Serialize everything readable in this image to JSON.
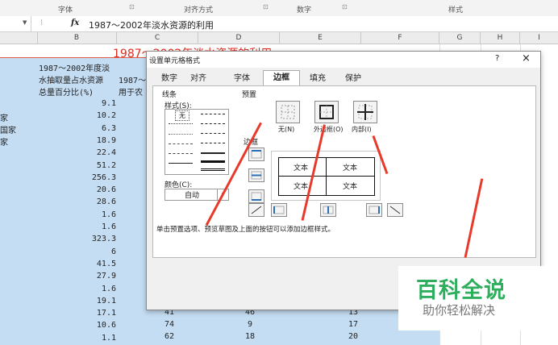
{
  "ribbon": {
    "groups": [
      "字体",
      "对齐方式",
      "数字",
      "样式"
    ]
  },
  "formula_bar": {
    "fx": "fx",
    "content": "1987～2002年淡水资源的利用"
  },
  "columns": [
    "B",
    "C",
    "D",
    "E",
    "F",
    "G",
    "H",
    "I"
  ],
  "sheet": {
    "title_visible": "1987～2002年淡水资源的利用",
    "b_header": [
      "1987～2002年度淡",
      "水抽取量占水资源",
      "总量百分比(%)"
    ],
    "c_header": [
      "1987～",
      "用于农"
    ],
    "row_labels_a": [
      "家",
      "国家",
      "家"
    ],
    "b_values": [
      "9.1",
      "10.2",
      "6.3",
      "18.9",
      "22.4",
      "51.2",
      "256.3",
      "20.6",
      "28.6",
      "1.6",
      "1.6",
      "323.3",
      "6",
      "41.5",
      "27.9",
      "1.6",
      "19.1",
      "17.1",
      "10.6",
      "1.1"
    ],
    "bottom_rows": [
      {
        "c": "41",
        "d": "46",
        "e": "13"
      },
      {
        "c": "74",
        "d": "9",
        "e": "17"
      },
      {
        "c": "62",
        "d": "18",
        "e": "20"
      }
    ]
  },
  "dialog": {
    "title": "设置单元格格式",
    "help": "?",
    "close": "×",
    "tabs": [
      "数字",
      "对齐",
      "字体",
      "边框",
      "填充",
      "保护"
    ],
    "active_tab": "边框",
    "line_section": "线条",
    "style_label": "样式(S):",
    "none_label": "无",
    "color_label": "颜色(C):",
    "color_value": "自动",
    "preset_label": "预置",
    "presets": [
      "无(N)",
      "外边框(O)",
      "内部(I)"
    ],
    "border_label": "边框",
    "preview_text": [
      "文本",
      "文本",
      "文本",
      "文本"
    ],
    "hint": "单击预置选项、预览草图及上面的按钮可以添加边框样式。"
  },
  "watermark": {
    "title": "百科全说",
    "subtitle": "助你轻松解决"
  }
}
